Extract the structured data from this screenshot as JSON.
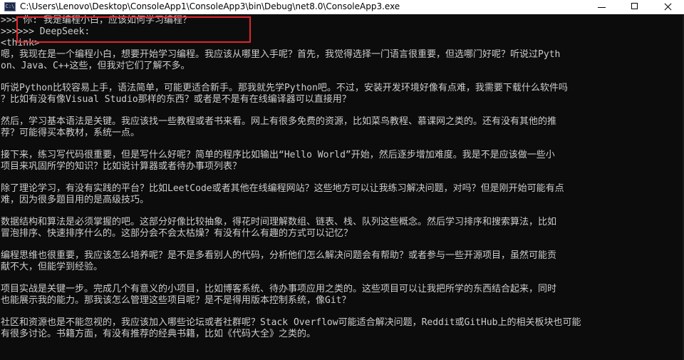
{
  "window": {
    "title": "C:\\Users\\Lenovo\\Desktop\\ConsoleApp1\\ConsoleApp3\\bin\\Debug\\net8.0\\ConsoleApp3.exe",
    "icon_label": "C:\\",
    "icon": "console-app-icon",
    "controls": [
      "minimize-icon",
      "maximize-icon",
      "close-icon"
    ]
  },
  "console": {
    "prompt_line": ">>> 你: 我是编程小白，应该如何学习编程？",
    "reply_line": ">>>>>> DeepSeek:",
    "think_tag": "<think>",
    "paragraphs": [
      [
        "嗯，我现在是一个编程小白，想要开始学习编程。我应该从哪里入手呢？首先，我觉得选择一门语言很重要，但选哪门好呢？听说过Pyth",
        "on、Java、C++这些，但我对它们了解不多。"
      ],
      [
        "听说Python比较容易上手，语法简单，可能更适合新手。那我就先学Python吧。不过，安装开发环境好像有点难，我需要下载什么软件吗",
        "？比如有没有像Visual Studio那样的东西？或者是不是有在线编译器可以直接用？"
      ],
      [
        "然后，学习基本语法是关键。我应该找一些教程或者书来看。网上有很多免费的资源，比如菜鸟教程、慕课网之类的。还有没有其他的推",
        "荐？可能得买本教材，系统一点。"
      ],
      [
        "接下来，练习写代码很重要，但是写什么好呢？简单的程序比如输出“Hello World”开始，然后逐步增加难度。我是不是应该做一些小",
        "项目来巩固所学的知识？比如说计算器或者待办事项列表？"
      ],
      [
        "除了理论学习，有没有实践的平台？比如LeetCode或者其他在线编程网站？这些地方可以让我练习解决问题，对吗？但是刚开始可能有点",
        "难，因为很多题目用的是高级技巧。"
      ],
      [
        "数据结构和算法是必须掌握的吧。这部分好像比较抽象，得花时间理解数组、链表、栈、队列这些概念。然后学习排序和搜索算法，比如",
        "冒泡排序、快速排序什么的。这部分会不会太枯燥？有没有什么有趣的方式可以记忆？"
      ],
      [
        "编程思维也很重要，我应该怎么培养呢？是不是多看别人的代码，分析他们怎么解决问题会有帮助？或者参与一些开源项目，虽然可能贡",
        "献不大，但能学到经验。"
      ],
      [
        "项目实战是关键一步。完成几个有意义的小项目，比如博客系统、待办事项应用之类的。这些项目可以让我把所学的东西结合起来，同时",
        "也能展示我的能力。那我该怎么管理这些项目呢？是不是得用版本控制系统，像Git？"
      ],
      [
        "社区和资源也是不能忽视的，我应该加入哪些论坛或者社群呢？Stack Overflow可能适合解决问题，Reddit或GitHub上的相关板块也可能",
        "有很多讨论。书籍方面，有没有推荐的经典书籍，比如《代码大全》之类的。"
      ]
    ]
  },
  "colors": {
    "console_bg": "#0c0c0c",
    "console_text": "#cccccc",
    "titlebar_bg": "#ffffff",
    "highlight": "#e0262b"
  }
}
